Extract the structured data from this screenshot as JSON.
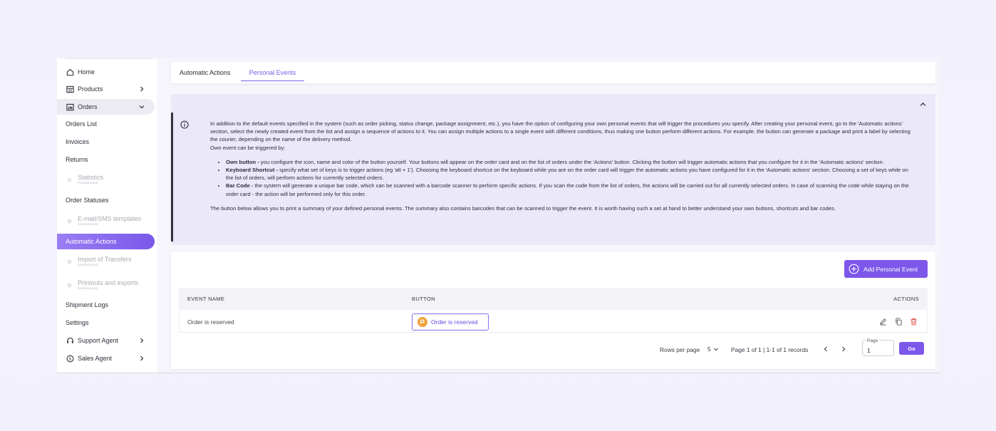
{
  "sidebar": {
    "home": "Home",
    "products": "Products",
    "orders": "Orders",
    "orders_list": "Orders List",
    "invoices": "Invoices",
    "returns": "Returns",
    "statistics": "Statistics",
    "statistics_soon": "(coming soon)",
    "order_statuses": "Order Statuses",
    "email_sms": "E-mail/SMS templates",
    "email_sms_soon": "(coming soon)",
    "automatic_actions": "Automatic Actions",
    "import_transfers": "Import of Transfers",
    "import_transfers_soon": "(coming soon)",
    "printouts": "Printouts and exports",
    "printouts_soon": "(coming soon)",
    "shipment_logs": "Shipment Logs",
    "settings": "Settings",
    "support_agent": "Support Agent",
    "sales_agent": "Sales Agent"
  },
  "tabs": {
    "automatic_actions": "Automatic Actions",
    "personal_events": "Personal Events"
  },
  "info": {
    "p1": "In addition to the default events specified in the system (such as order picking, status change, package assignment, etc.), you have the option of configuring your own personal events that will trigger the procedures you specify. After creating your personal event, go to the 'Automatic actions' section, select the newly created event from the list and assign a sequence of actions to it. You can assign multiple actions to a single event with different conditions, thus making one button perform different actions. For example, the button can generate a package and print a label by selecting the courier, depending on the name of the delivery method.",
    "p2": "Own event can be triggered by:",
    "b1_title": "Own button -",
    "b1_text": " you configure the icon, name and color of the button yourself. Your buttons will appear on the order card and on the list of orders under the 'Actions' button. Clicking the button will trigger automatic actions that you configure for it in the 'Automatic actions' section.",
    "b2_title": "Keyboard Shortcut -",
    "b2_text": " specify what set of keys is to trigger actions (eg 'alt + 1'). Choosing the keyboard shortcut on the keyboard while you are on the order card will trigger the automatic actions you have configured for it in the 'Automatic actions' section. Choosing a set of keys while on the list of orders, will perform actions for currently selected orders.",
    "b3_title": "Bar Code -",
    "b3_text": " the system will generate a unique bar code, which can be scanned with a barcode scanner to perform specific actions. If you scan the code from the list of orders, the actions will be carried out for all currently selected orders. In case of scanning the code while staying on the order card - the action will be performed only for this order.",
    "p3": "The button below allows you to print a summary of your defined personal events. The summary also contains barcodes that can be scanned to trigger the event. It is worth having such a set at hand to better understand your own buttons, shortcuts and bar codes."
  },
  "table": {
    "add_button": "Add Personal Event",
    "headers": {
      "event_name": "EVENT NAME",
      "button": "BUTTON",
      "actions": "ACTIONS"
    },
    "rows": [
      {
        "event_name": "Order is reserved",
        "button_label": "Order is reserved",
        "button_color": "#f0a23a"
      }
    ]
  },
  "pagination": {
    "rows_per_page_label": "Rows per page",
    "rows_per_page_value": "5",
    "page_info": "Page 1 of 1 | 1-1 of 1 records",
    "page_label": "Page",
    "page_value": "1",
    "go_label": "Go"
  },
  "colors": {
    "accent": "#7c57ea",
    "info_bg": "#ebe8f7",
    "delete": "#e0463f"
  },
  "icons": [
    "home-icon",
    "products-icon",
    "orders-icon",
    "chevron-right-icon",
    "chevron-down-icon",
    "support-agent-icon",
    "sales-agent-icon",
    "info-icon",
    "chevron-up-icon",
    "plus-circle-icon",
    "flag-icon",
    "edit-icon",
    "copy-icon",
    "trash-icon",
    "chevron-left-icon"
  ]
}
